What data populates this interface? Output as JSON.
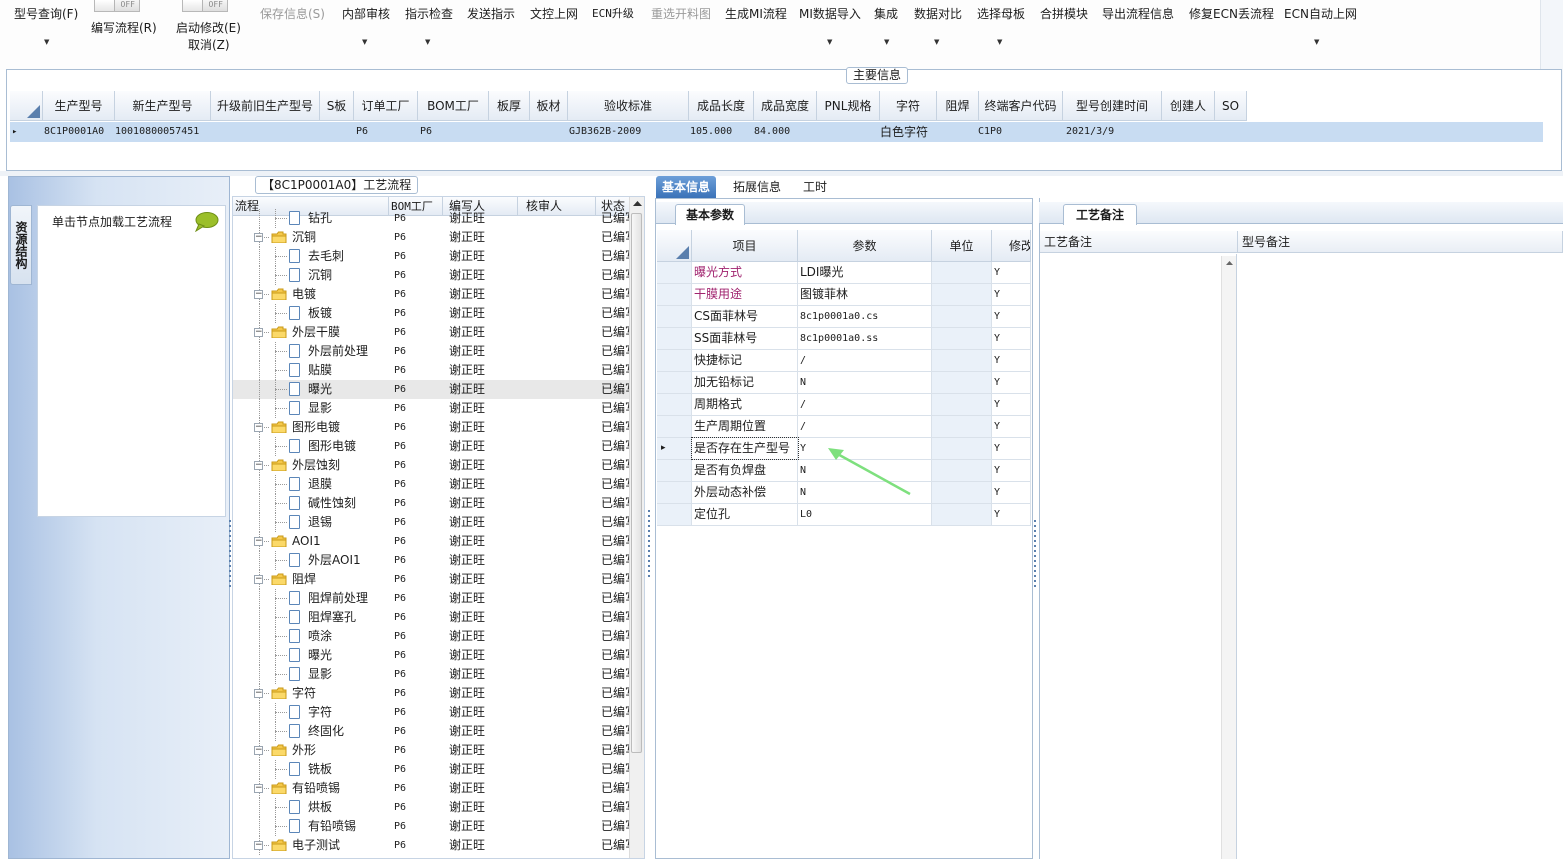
{
  "toolbar": {
    "items": [
      {
        "label": "型号查询(F)",
        "disabled": false
      },
      {
        "label": "编写流程(R)",
        "disabled": false
      },
      {
        "label": "启动修改(E)",
        "disabled": false
      },
      {
        "label": "取消(Z)",
        "disabled": false
      },
      {
        "label": "保存信息(S)",
        "disabled": true
      },
      {
        "label": "内部审核",
        "disabled": false
      },
      {
        "label": "指示检查",
        "disabled": false
      },
      {
        "label": "发送指示",
        "disabled": false
      },
      {
        "label": "文控上网",
        "disabled": false
      },
      {
        "label": "ECN升级",
        "disabled": false
      },
      {
        "label": "重选开料图",
        "disabled": true
      },
      {
        "label": "生成MI流程",
        "disabled": false
      },
      {
        "label": "MI数据导入",
        "disabled": false
      },
      {
        "label": "集成",
        "disabled": false
      },
      {
        "label": "数据对比",
        "disabled": false
      },
      {
        "label": "选择母板",
        "disabled": false
      },
      {
        "label": "合拼模块",
        "disabled": false
      },
      {
        "label": "导出流程信息",
        "disabled": false
      },
      {
        "label": "修复ECN丢流程",
        "disabled": false
      },
      {
        "label": "ECN自动上网",
        "disabled": false
      }
    ],
    "toggle_label": "OFF"
  },
  "main_info": {
    "legend": "主要信息",
    "columns": [
      "生产型号",
      "新生产型号",
      "升级前旧生产型号",
      "S板",
      "订单工厂",
      "BOM工厂",
      "板厚",
      "板材",
      "验收标准",
      "成品长度",
      "成品宽度",
      "PNL规格",
      "字符",
      "阻焊",
      "终端客户代码",
      "型号创建时间",
      "创建人",
      "SO"
    ],
    "row": [
      "8C1P0001A0",
      "10010800057451",
      "",
      "",
      "P6",
      "P6",
      "",
      "",
      "GJB362B-2009",
      "105.000",
      "84.000",
      "",
      "白色字符",
      "",
      "C1P0",
      "2021/3/9",
      "",
      ""
    ],
    "row_marker": "▸"
  },
  "left_panel": {
    "vertical_tab": "资源结构",
    "load_hint": "单击节点加载工艺流程"
  },
  "tree": {
    "title": "【8C1P0001A0】工艺流程",
    "columns": [
      "流程",
      "BOM工厂",
      "编写人",
      "核审人",
      "状态"
    ],
    "rows": [
      {
        "name": "钻孔",
        "level": 2,
        "factory": "P6",
        "writer": "谢正旺",
        "reviewer": "",
        "status": "已编写"
      },
      {
        "name": "沉铜",
        "level": 1,
        "factory": "P6",
        "writer": "谢正旺",
        "reviewer": "",
        "status": "已编写"
      },
      {
        "name": "去毛刺",
        "level": 2,
        "factory": "P6",
        "writer": "谢正旺",
        "reviewer": "",
        "status": "已编写"
      },
      {
        "name": "沉铜",
        "level": 2,
        "factory": "P6",
        "writer": "谢正旺",
        "reviewer": "",
        "status": "已编写"
      },
      {
        "name": "电镀",
        "level": 1,
        "factory": "P6",
        "writer": "谢正旺",
        "reviewer": "",
        "status": "已编写"
      },
      {
        "name": "板镀",
        "level": 2,
        "factory": "P6",
        "writer": "谢正旺",
        "reviewer": "",
        "status": "已编写"
      },
      {
        "name": "外层干膜",
        "level": 1,
        "factory": "P6",
        "writer": "谢正旺",
        "reviewer": "",
        "status": "已编写"
      },
      {
        "name": "外层前处理",
        "level": 2,
        "factory": "P6",
        "writer": "谢正旺",
        "reviewer": "",
        "status": "已编写"
      },
      {
        "name": "贴膜",
        "level": 2,
        "factory": "P6",
        "writer": "谢正旺",
        "reviewer": "",
        "status": "已编写"
      },
      {
        "name": "曝光",
        "level": 2,
        "factory": "P6",
        "writer": "谢正旺",
        "reviewer": "",
        "status": "已编写",
        "selected": true
      },
      {
        "name": "显影",
        "level": 2,
        "factory": "P6",
        "writer": "谢正旺",
        "reviewer": "",
        "status": "已编写"
      },
      {
        "name": "图形电镀",
        "level": 1,
        "factory": "P6",
        "writer": "谢正旺",
        "reviewer": "",
        "status": "已编写"
      },
      {
        "name": "图形电镀",
        "level": 2,
        "factory": "P6",
        "writer": "谢正旺",
        "reviewer": "",
        "status": "已编写"
      },
      {
        "name": "外层蚀刻",
        "level": 1,
        "factory": "P6",
        "writer": "谢正旺",
        "reviewer": "",
        "status": "已编写"
      },
      {
        "name": "退膜",
        "level": 2,
        "factory": "P6",
        "writer": "谢正旺",
        "reviewer": "",
        "status": "已编写"
      },
      {
        "name": "碱性蚀刻",
        "level": 2,
        "factory": "P6",
        "writer": "谢正旺",
        "reviewer": "",
        "status": "已编写"
      },
      {
        "name": "退锡",
        "level": 2,
        "factory": "P6",
        "writer": "谢正旺",
        "reviewer": "",
        "status": "已编写"
      },
      {
        "name": "AOI1",
        "level": 1,
        "factory": "P6",
        "writer": "谢正旺",
        "reviewer": "",
        "status": "已编写"
      },
      {
        "name": "外层AOI1",
        "level": 2,
        "factory": "P6",
        "writer": "谢正旺",
        "reviewer": "",
        "status": "已编写"
      },
      {
        "name": "阻焊",
        "level": 1,
        "factory": "P6",
        "writer": "谢正旺",
        "reviewer": "",
        "status": "已编写"
      },
      {
        "name": "阻焊前处理",
        "level": 2,
        "factory": "P6",
        "writer": "谢正旺",
        "reviewer": "",
        "status": "已编写"
      },
      {
        "name": "阻焊塞孔",
        "level": 2,
        "factory": "P6",
        "writer": "谢正旺",
        "reviewer": "",
        "status": "已编写"
      },
      {
        "name": "喷涂",
        "level": 2,
        "factory": "P6",
        "writer": "谢正旺",
        "reviewer": "",
        "status": "已编写"
      },
      {
        "name": "曝光",
        "level": 2,
        "factory": "P6",
        "writer": "谢正旺",
        "reviewer": "",
        "status": "已编写"
      },
      {
        "name": "显影",
        "level": 2,
        "factory": "P6",
        "writer": "谢正旺",
        "reviewer": "",
        "status": "已编写"
      },
      {
        "name": "字符",
        "level": 1,
        "factory": "P6",
        "writer": "谢正旺",
        "reviewer": "",
        "status": "已编写"
      },
      {
        "name": "字符",
        "level": 2,
        "factory": "P6",
        "writer": "谢正旺",
        "reviewer": "",
        "status": "已编写"
      },
      {
        "name": "终固化",
        "level": 2,
        "factory": "P6",
        "writer": "谢正旺",
        "reviewer": "",
        "status": "已编写"
      },
      {
        "name": "外形",
        "level": 1,
        "factory": "P6",
        "writer": "谢正旺",
        "reviewer": "",
        "status": "已编写"
      },
      {
        "name": "铣板",
        "level": 2,
        "factory": "P6",
        "writer": "谢正旺",
        "reviewer": "",
        "status": "已编写"
      },
      {
        "name": "有铅喷锡",
        "level": 1,
        "factory": "P6",
        "writer": "谢正旺",
        "reviewer": "",
        "status": "已编写"
      },
      {
        "name": "烘板",
        "level": 2,
        "factory": "P6",
        "writer": "谢正旺",
        "reviewer": "",
        "status": "已编写"
      },
      {
        "name": "有铅喷锡",
        "level": 2,
        "factory": "P6",
        "writer": "谢正旺",
        "reviewer": "",
        "status": "已编写"
      },
      {
        "name": "电子测试",
        "level": 1,
        "factory": "P6",
        "writer": "谢正旺",
        "reviewer": "",
        "status": "已编写"
      }
    ]
  },
  "mid_panel": {
    "tabs": [
      "基本信息",
      "拓展信息",
      "工时"
    ],
    "active_tab": 0,
    "sub_tab": "基本参数",
    "columns": [
      "项目",
      "参数",
      "单位",
      "修改"
    ],
    "rows": [
      {
        "item": "曝光方式",
        "value": "LDI曝光",
        "unit": "",
        "modify": "Y",
        "highlight": true
      },
      {
        "item": "干膜用途",
        "value": "图镀菲林",
        "unit": "",
        "modify": "Y",
        "highlight": true
      },
      {
        "item": "CS面菲林号",
        "value": "8c1p0001a0.cs",
        "unit": "",
        "modify": "Y",
        "highlight": false
      },
      {
        "item": "SS面菲林号",
        "value": "8c1p0001a0.ss",
        "unit": "",
        "modify": "Y",
        "highlight": false
      },
      {
        "item": "快捷标记",
        "value": "/",
        "unit": "",
        "modify": "Y",
        "highlight": false
      },
      {
        "item": "加无铅标记",
        "value": "N",
        "unit": "",
        "modify": "Y",
        "highlight": false
      },
      {
        "item": "周期格式",
        "value": "/",
        "unit": "",
        "modify": "Y",
        "highlight": false
      },
      {
        "item": "生产周期位置",
        "value": "/",
        "unit": "",
        "modify": "Y",
        "highlight": false
      },
      {
        "item": "是否存在生产型号",
        "value": "Y",
        "unit": "",
        "modify": "Y",
        "highlight": false,
        "current": true
      },
      {
        "item": "是否有负焊盘",
        "value": "N",
        "unit": "",
        "modify": "Y",
        "highlight": false
      },
      {
        "item": "外层动态补偿",
        "value": "N",
        "unit": "",
        "modify": "Y",
        "highlight": false
      },
      {
        "item": "定位孔",
        "value": "L0",
        "unit": "",
        "modify": "Y",
        "highlight": false
      }
    ],
    "row_marker": "▸"
  },
  "right_panel": {
    "tab": "工艺备注",
    "columns": [
      "工艺备注",
      "型号备注"
    ]
  },
  "colors": {
    "accent_blue": "#3a72b8",
    "selected_row": "#c8dcf2",
    "highlight_text": "#a0226e",
    "arrow_green": "#7ee07e"
  }
}
